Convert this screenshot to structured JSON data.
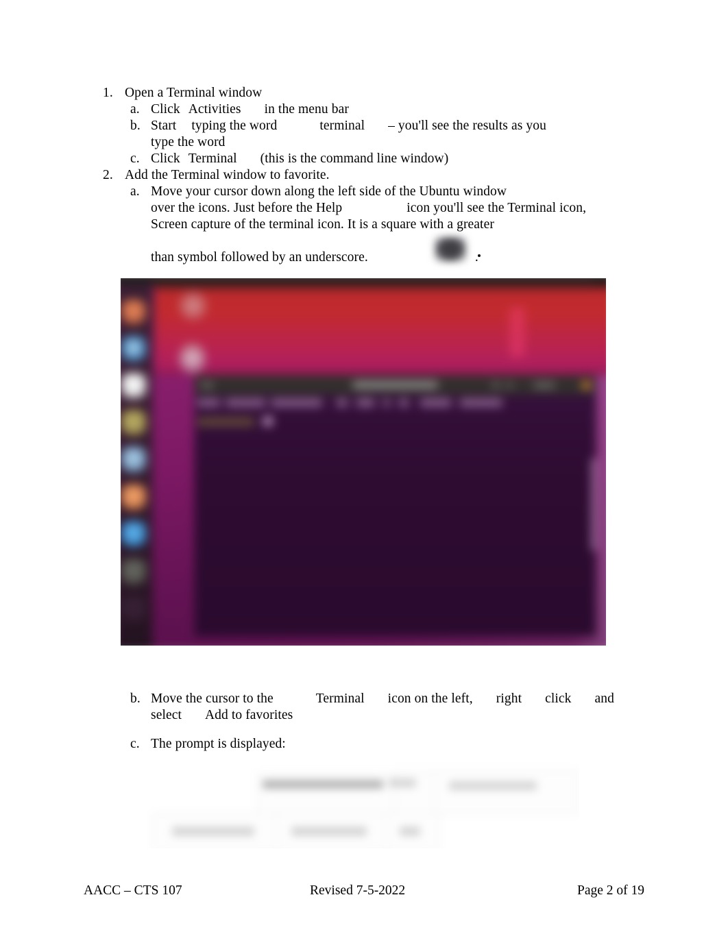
{
  "document": {
    "steps": [
      {
        "number": "1.",
        "title": "Open a Terminal window",
        "substeps": [
          {
            "letter": "a.",
            "part1": "Click",
            "term": "Activities",
            "part2": "in the menu bar"
          },
          {
            "letter": "b.",
            "part1": "Start",
            "part2": "typing the word",
            "term": "terminal",
            "part3": "– you'll see the results as you",
            "cont": "type the word"
          },
          {
            "letter": "c.",
            "part1": "Click",
            "term": "Terminal",
            "part2": "(this is the command line window)"
          }
        ]
      },
      {
        "number": "2.",
        "title": "Add the Terminal window to favorite.",
        "substeps": [
          {
            "letter": "a.",
            "line1": "Move your cursor down along the left side of the Ubuntu window",
            "line2a": "over the icons. Just before the Help",
            "line2b": "icon you'll see the Terminal icon,",
            "line3": "Screen capture of the terminal icon. It is a square with a greater",
            "line4a": "than symbol followed by an underscore.",
            "line4b": "."
          },
          {
            "letter": "b.",
            "part1": "Move the cursor to the",
            "term1": "Terminal",
            "part2": "icon on the left,",
            "part3": "right",
            "part4": "click",
            "part5": "and",
            "cont1": "select",
            "cont2": "Add to favorites"
          },
          {
            "letter": "c.",
            "text": "The prompt is displayed:"
          }
        ]
      }
    ]
  },
  "desktop_screenshot": {
    "description": "Blurred screenshot of Ubuntu desktop with Activities overview and Terminal window",
    "wallpaper_color": "#7b1f63",
    "panel_gradient_start": "#c22a2e",
    "panel_gradient_end": "#b01f5e",
    "terminal_background": "#2d0a2e",
    "terminal_titlebar": "#332f2d",
    "dock_background": "#281e26",
    "dock_icons": [
      {
        "name": "dock-icon-firefox",
        "color": "#d4714a"
      },
      {
        "name": "dock-icon-thunderbird",
        "color": "#4a8fc4"
      },
      {
        "name": "dock-icon-files",
        "color": "#e8e8e8"
      },
      {
        "name": "dock-icon-rhythmbox",
        "color": "#a89a55"
      },
      {
        "name": "dock-icon-libreoffice-writer",
        "color": "#7fa8cc"
      },
      {
        "name": "dock-icon-software",
        "color": "#e08a52"
      },
      {
        "name": "dock-icon-help",
        "color": "#3d95d8"
      }
    ]
  },
  "prompt_screenshot": {
    "description": "Blurred screenshot of the command prompt / dialog"
  },
  "footer": {
    "left": "AACC – CTS 107",
    "middle": "Revised 7-5-2022",
    "right": "Page 2 of 19"
  }
}
